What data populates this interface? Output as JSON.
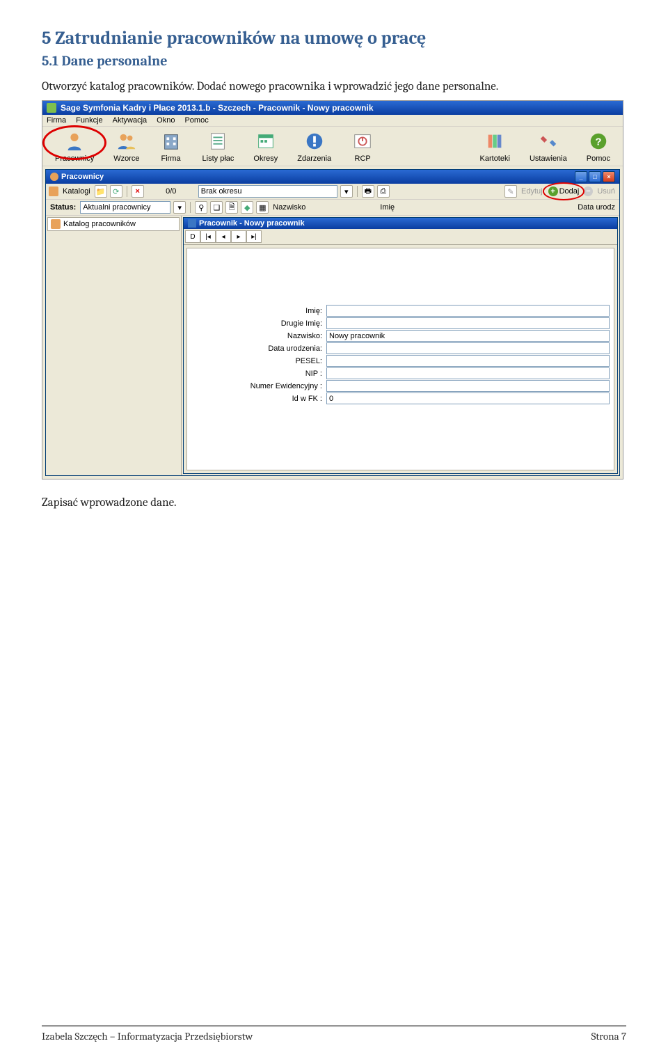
{
  "headings": {
    "h5": "5   Zatrudnianie pracowników na umowę o pracę",
    "h51": "5.1   Dane personalne"
  },
  "paras": {
    "p1": "Otworzyć katalog pracowników. Dodać nowego pracownika i wprowadzić jego dane personalne.",
    "p2": "Zapisać wprowadzone dane."
  },
  "app": {
    "title": "Sage Symfonia Kadry i Płace 2013.1.b - Szczech - Pracownik - Nowy pracownik",
    "menu": [
      "Firma",
      "Funkcje",
      "Aktywacja",
      "Okno",
      "Pomoc"
    ],
    "toolbar": [
      {
        "label": "Pracownicy"
      },
      {
        "label": "Wzorce"
      },
      {
        "label": "Firma"
      },
      {
        "label": "Listy płac"
      },
      {
        "label": "Okresy"
      },
      {
        "label": "Zdarzenia"
      },
      {
        "label": "RCP"
      },
      {
        "label": "Kartoteki"
      },
      {
        "label": "Ustawienia"
      },
      {
        "label": "Pomoc"
      }
    ]
  },
  "sub": {
    "title": "Pracownicy",
    "row1": {
      "katalogi": "Katalogi",
      "counter": "0/0",
      "okres": "Brak okresu",
      "edytuj": "Edytuj",
      "dodaj": "Dodaj",
      "usun": "Usuń"
    },
    "row2": {
      "statuslbl": "Status:",
      "statusval": "Aktualni pracownicy",
      "nazwisko": "Nazwisko",
      "imie": "Imię",
      "dataurodz": "Data urodz"
    },
    "tree": "Katalog pracowników"
  },
  "inner": {
    "title": "Pracownik - Nowy pracownik",
    "fields": {
      "imie": {
        "label": "Imię:",
        "value": ""
      },
      "drugie": {
        "label": "Drugie Imię:",
        "value": ""
      },
      "nazwisko": {
        "label": "Nazwisko:",
        "value": "Nowy pracownik"
      },
      "dataur": {
        "label": "Data urodzenia:",
        "value": ""
      },
      "pesel": {
        "label": "PESEL:",
        "value": ""
      },
      "nip": {
        "label": "NIP :",
        "value": ""
      },
      "numew": {
        "label": "Numer Ewidencyjny :",
        "value": ""
      },
      "idfk": {
        "label": "Id w FK :",
        "value": "0"
      }
    }
  },
  "footer": {
    "left": "Izabela Szczęch – Informatyzacja Przedsiębiorstw",
    "right": "Strona 7"
  }
}
